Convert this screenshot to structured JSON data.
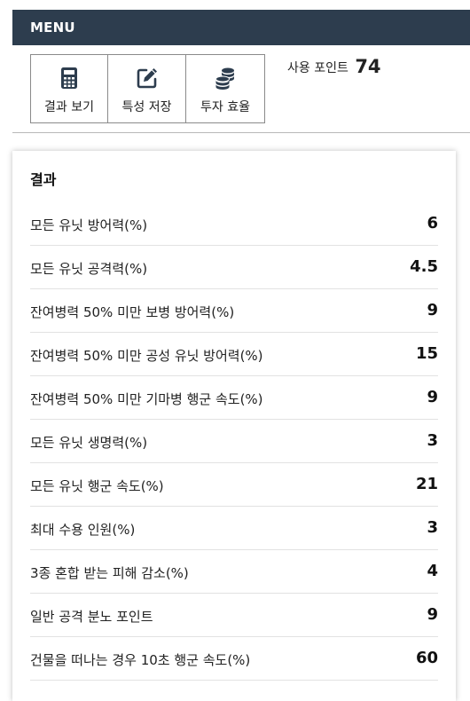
{
  "menu": {
    "title": "MENU"
  },
  "buttons": [
    {
      "label": "결과 보기",
      "icon": "calculator-icon"
    },
    {
      "label": "특성 저장",
      "icon": "edit-icon"
    },
    {
      "label": "투자 효율",
      "icon": "coins-icon"
    }
  ],
  "points": {
    "label": "사용 포인트",
    "value": "74"
  },
  "results": {
    "title": "결과",
    "rows": [
      {
        "label": "모든 유닛 방어력(%)",
        "value": "6"
      },
      {
        "label": "모든 유닛 공격력(%)",
        "value": "4.5"
      },
      {
        "label": "잔여병력 50% 미만 보병 방어력(%)",
        "value": "9"
      },
      {
        "label": "잔여병력 50% 미만 공성 유닛 방어력(%)",
        "value": "15"
      },
      {
        "label": "잔여병력 50% 미만 기마병 행군 속도(%)",
        "value": "9"
      },
      {
        "label": "모든 유닛 생명력(%)",
        "value": "3"
      },
      {
        "label": "모든 유닛 행군 속도(%)",
        "value": "21"
      },
      {
        "label": "최대 수용 인원(%)",
        "value": "3"
      },
      {
        "label": "3종 혼합 받는 피해 감소(%)",
        "value": "4"
      },
      {
        "label": "일반 공격 분노 포인트",
        "value": "9"
      },
      {
        "label": "건물을 떠나는 경우 10초 행군 속도(%)",
        "value": "60"
      }
    ]
  },
  "colors": {
    "header_bg": "#2d3d4e",
    "icon": "#2d3d4e"
  }
}
